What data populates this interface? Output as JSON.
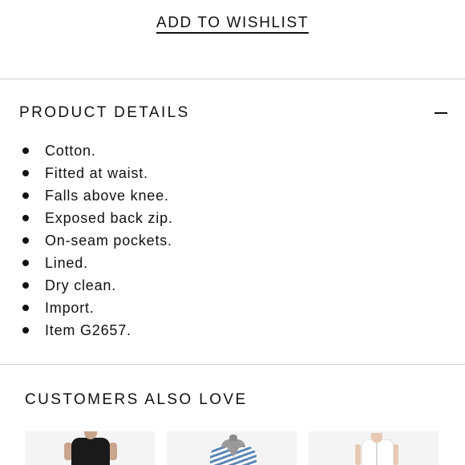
{
  "wishlist": {
    "label": "ADD TO WISHLIST"
  },
  "product_details": {
    "title": "PRODUCT DETAILS",
    "toggle_icon": "minus-icon",
    "items": [
      "Cotton.",
      "Fitted at waist.",
      "Falls above knee.",
      "Exposed back zip.",
      "On-seam pockets.",
      "Lined.",
      "Dry clean.",
      "Import.",
      "Item G2657."
    ]
  },
  "customers_also_love": {
    "title": "CUSTOMERS ALSO LOVE",
    "products": [
      {
        "thumbnail": "black-dress-image"
      },
      {
        "thumbnail": "striped-dress-image"
      },
      {
        "thumbnail": "white-dress-image"
      }
    ]
  }
}
